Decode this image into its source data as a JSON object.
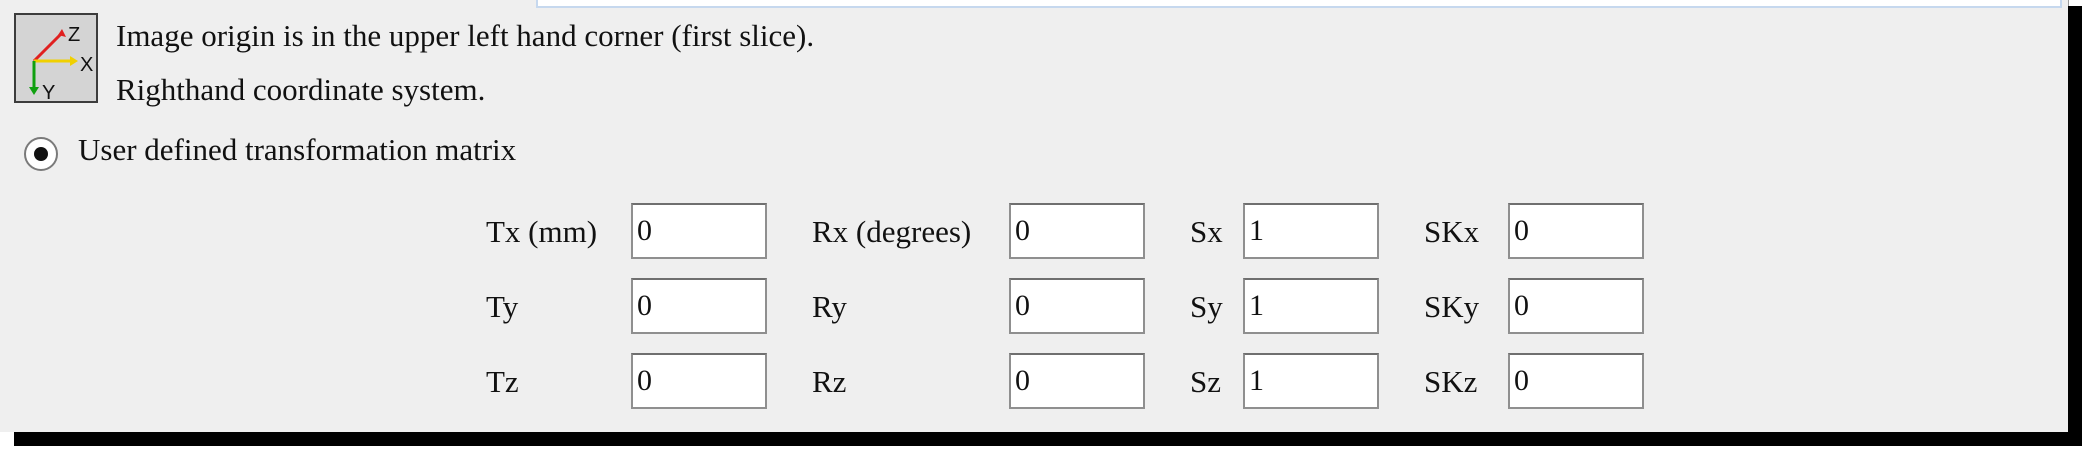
{
  "info": {
    "line1": "Image origin is in the upper left hand corner (first slice).",
    "line2": "Righthand coordinate system.",
    "axis_icon": "axis-orientation-icon",
    "axis_labels": {
      "z": "Z",
      "x": "X",
      "y": "Y"
    },
    "axis_colors": {
      "z": "#e02020",
      "x": "#f0d000",
      "y": "#10a010"
    }
  },
  "mode": {
    "label": "User defined transformation matrix",
    "selected": true
  },
  "matrix": {
    "translation": {
      "x_label": "Tx (mm)",
      "x_value": "0",
      "y_label": "Ty",
      "y_value": "0",
      "z_label": "Tz",
      "z_value": "0"
    },
    "rotation": {
      "x_label": "Rx (degrees)",
      "x_value": "0",
      "y_label": "Ry",
      "y_value": "0",
      "z_label": "Rz",
      "z_value": "0"
    },
    "scale": {
      "x_label": "Sx",
      "x_value": "1",
      "y_label": "Sy",
      "y_value": "1",
      "z_label": "Sz",
      "z_value": "1"
    },
    "skew": {
      "x_label": "SKx",
      "x_value": "0",
      "y_label": "SKy",
      "y_value": "0",
      "z_label": "SKz",
      "z_value": "0"
    }
  }
}
